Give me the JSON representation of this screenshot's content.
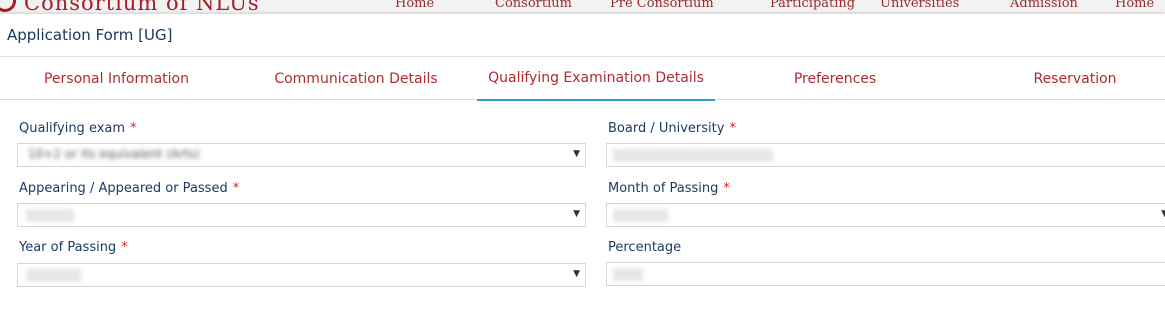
{
  "site": {
    "title": "Consortium of NLUs",
    "nav": [
      "Home",
      "Consortium",
      "Pre Consortium",
      "Participating",
      "Universities",
      "Admission",
      "Home"
    ]
  },
  "modal": {
    "title": "Application Form [UG]"
  },
  "tabs": [
    {
      "label": "Personal Information",
      "active": false
    },
    {
      "label": "Communication Details",
      "active": false
    },
    {
      "label": "Qualifying Examination Details",
      "active": true
    },
    {
      "label": "Preferences",
      "active": false
    },
    {
      "label": "Reservation",
      "active": false
    }
  ],
  "form": {
    "required_marker": "*",
    "qualifying_exam": {
      "label": "Qualifying exam",
      "value": "10+2 or its equivalent (Arts)"
    },
    "board_university": {
      "label": "Board / University"
    },
    "appearing_status": {
      "label": "Appearing / Appeared or Passed"
    },
    "month_of_passing": {
      "label": "Month of Passing"
    },
    "year_of_passing": {
      "label": "Year of Passing"
    },
    "percentage": {
      "label": "Percentage"
    }
  },
  "colors": {
    "brand": "#a51d24",
    "tab_text": "#b22a31",
    "active_underline": "#2a9fd6",
    "label_text": "#1d3b62",
    "required": "#d9232d"
  },
  "icons": {
    "dropdown": "dropdown-caret-icon"
  }
}
